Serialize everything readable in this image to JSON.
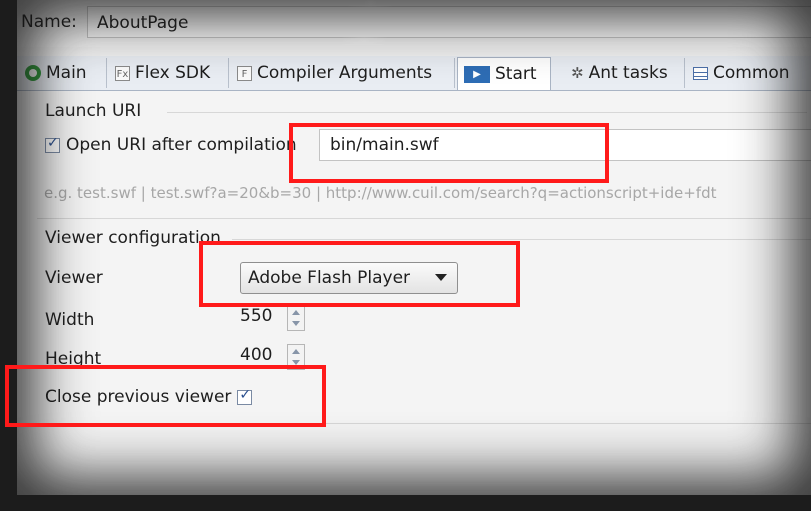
{
  "name_row": {
    "label": "Name:",
    "value": "AboutPage"
  },
  "tabs": [
    {
      "label": "Main",
      "icon": "run-icon"
    },
    {
      "label": "Flex SDK",
      "icon": "flex-sdk-icon"
    },
    {
      "label": "Compiler Arguments",
      "icon": "compiler-arguments-icon"
    },
    {
      "label": "Start",
      "icon": "start-icon",
      "active": true
    },
    {
      "label": "Ant tasks",
      "icon": "ant-icon"
    },
    {
      "label": "Common",
      "icon": "common-icon"
    }
  ],
  "tab_icon_text": {
    "flex_sdk": "Fx",
    "compiler": "F",
    "start": "▶"
  },
  "launch": {
    "section_title": "Launch URI",
    "open_uri_label": "Open URI after compilation",
    "open_uri_checked": true,
    "uri_value": "bin/main.swf",
    "hint": "e.g. test.swf | test.swf?a=20&b=30 | http://www.cuil.com/search?q=actionscript+ide+fdt"
  },
  "viewer": {
    "section_title": "Viewer configuration",
    "viewer_label": "Viewer",
    "viewer_value": "Adobe Flash Player",
    "width_label": "Width",
    "width_value": "550",
    "height_label": "Height",
    "height_value": "400",
    "close_previous_label": "Close previous viewer",
    "close_previous_checked": true
  },
  "colors": {
    "highlight": "#ff1a1a",
    "active_tab_accent": "#2e6db5",
    "hint_text": "#a7a7a7"
  }
}
